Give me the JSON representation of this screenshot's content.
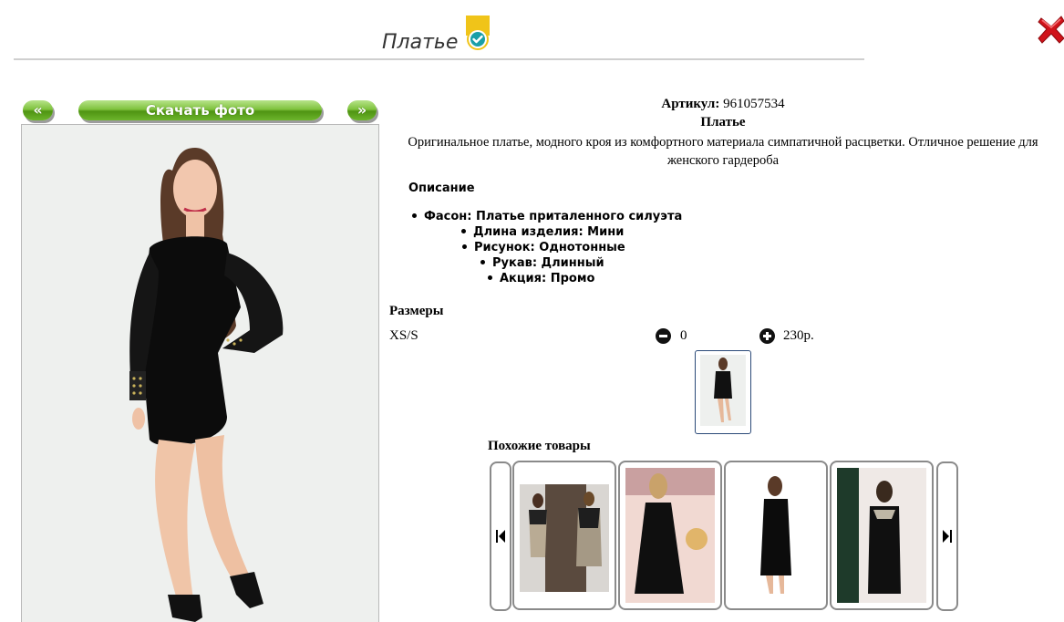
{
  "header": {
    "title": "Платье",
    "verified_icon": "verified-check-icon",
    "close_icon": "close-icon"
  },
  "gallery": {
    "prev_label": "«",
    "download_label": "Скачать фото",
    "next_label": "»"
  },
  "product": {
    "article_label": "Артикул:",
    "article_value": "961057534",
    "name": "Платье",
    "description": "Оригинальное платье, модного кроя из комфортного материала симпатичной расцветки. Отличное решение для женского гардероба"
  },
  "specs": {
    "heading": "Описание",
    "items": [
      "Фасон: Платье приталенного силуэта",
      "Длина изделия: Мини",
      "Рисунок: Однотонные",
      "Рукав: Длинный",
      "Акция: Промо"
    ]
  },
  "sizes": {
    "heading": "Размеры",
    "rows": [
      {
        "size": "XS/S",
        "qty": "0",
        "price": "230р."
      }
    ]
  },
  "similar": {
    "heading": "Похожие товары"
  },
  "colors": {
    "accent_green": "#6db52c",
    "close_red": "#d0131a",
    "verified_gold": "#f0c419",
    "verified_teal": "#1a9fa8"
  }
}
